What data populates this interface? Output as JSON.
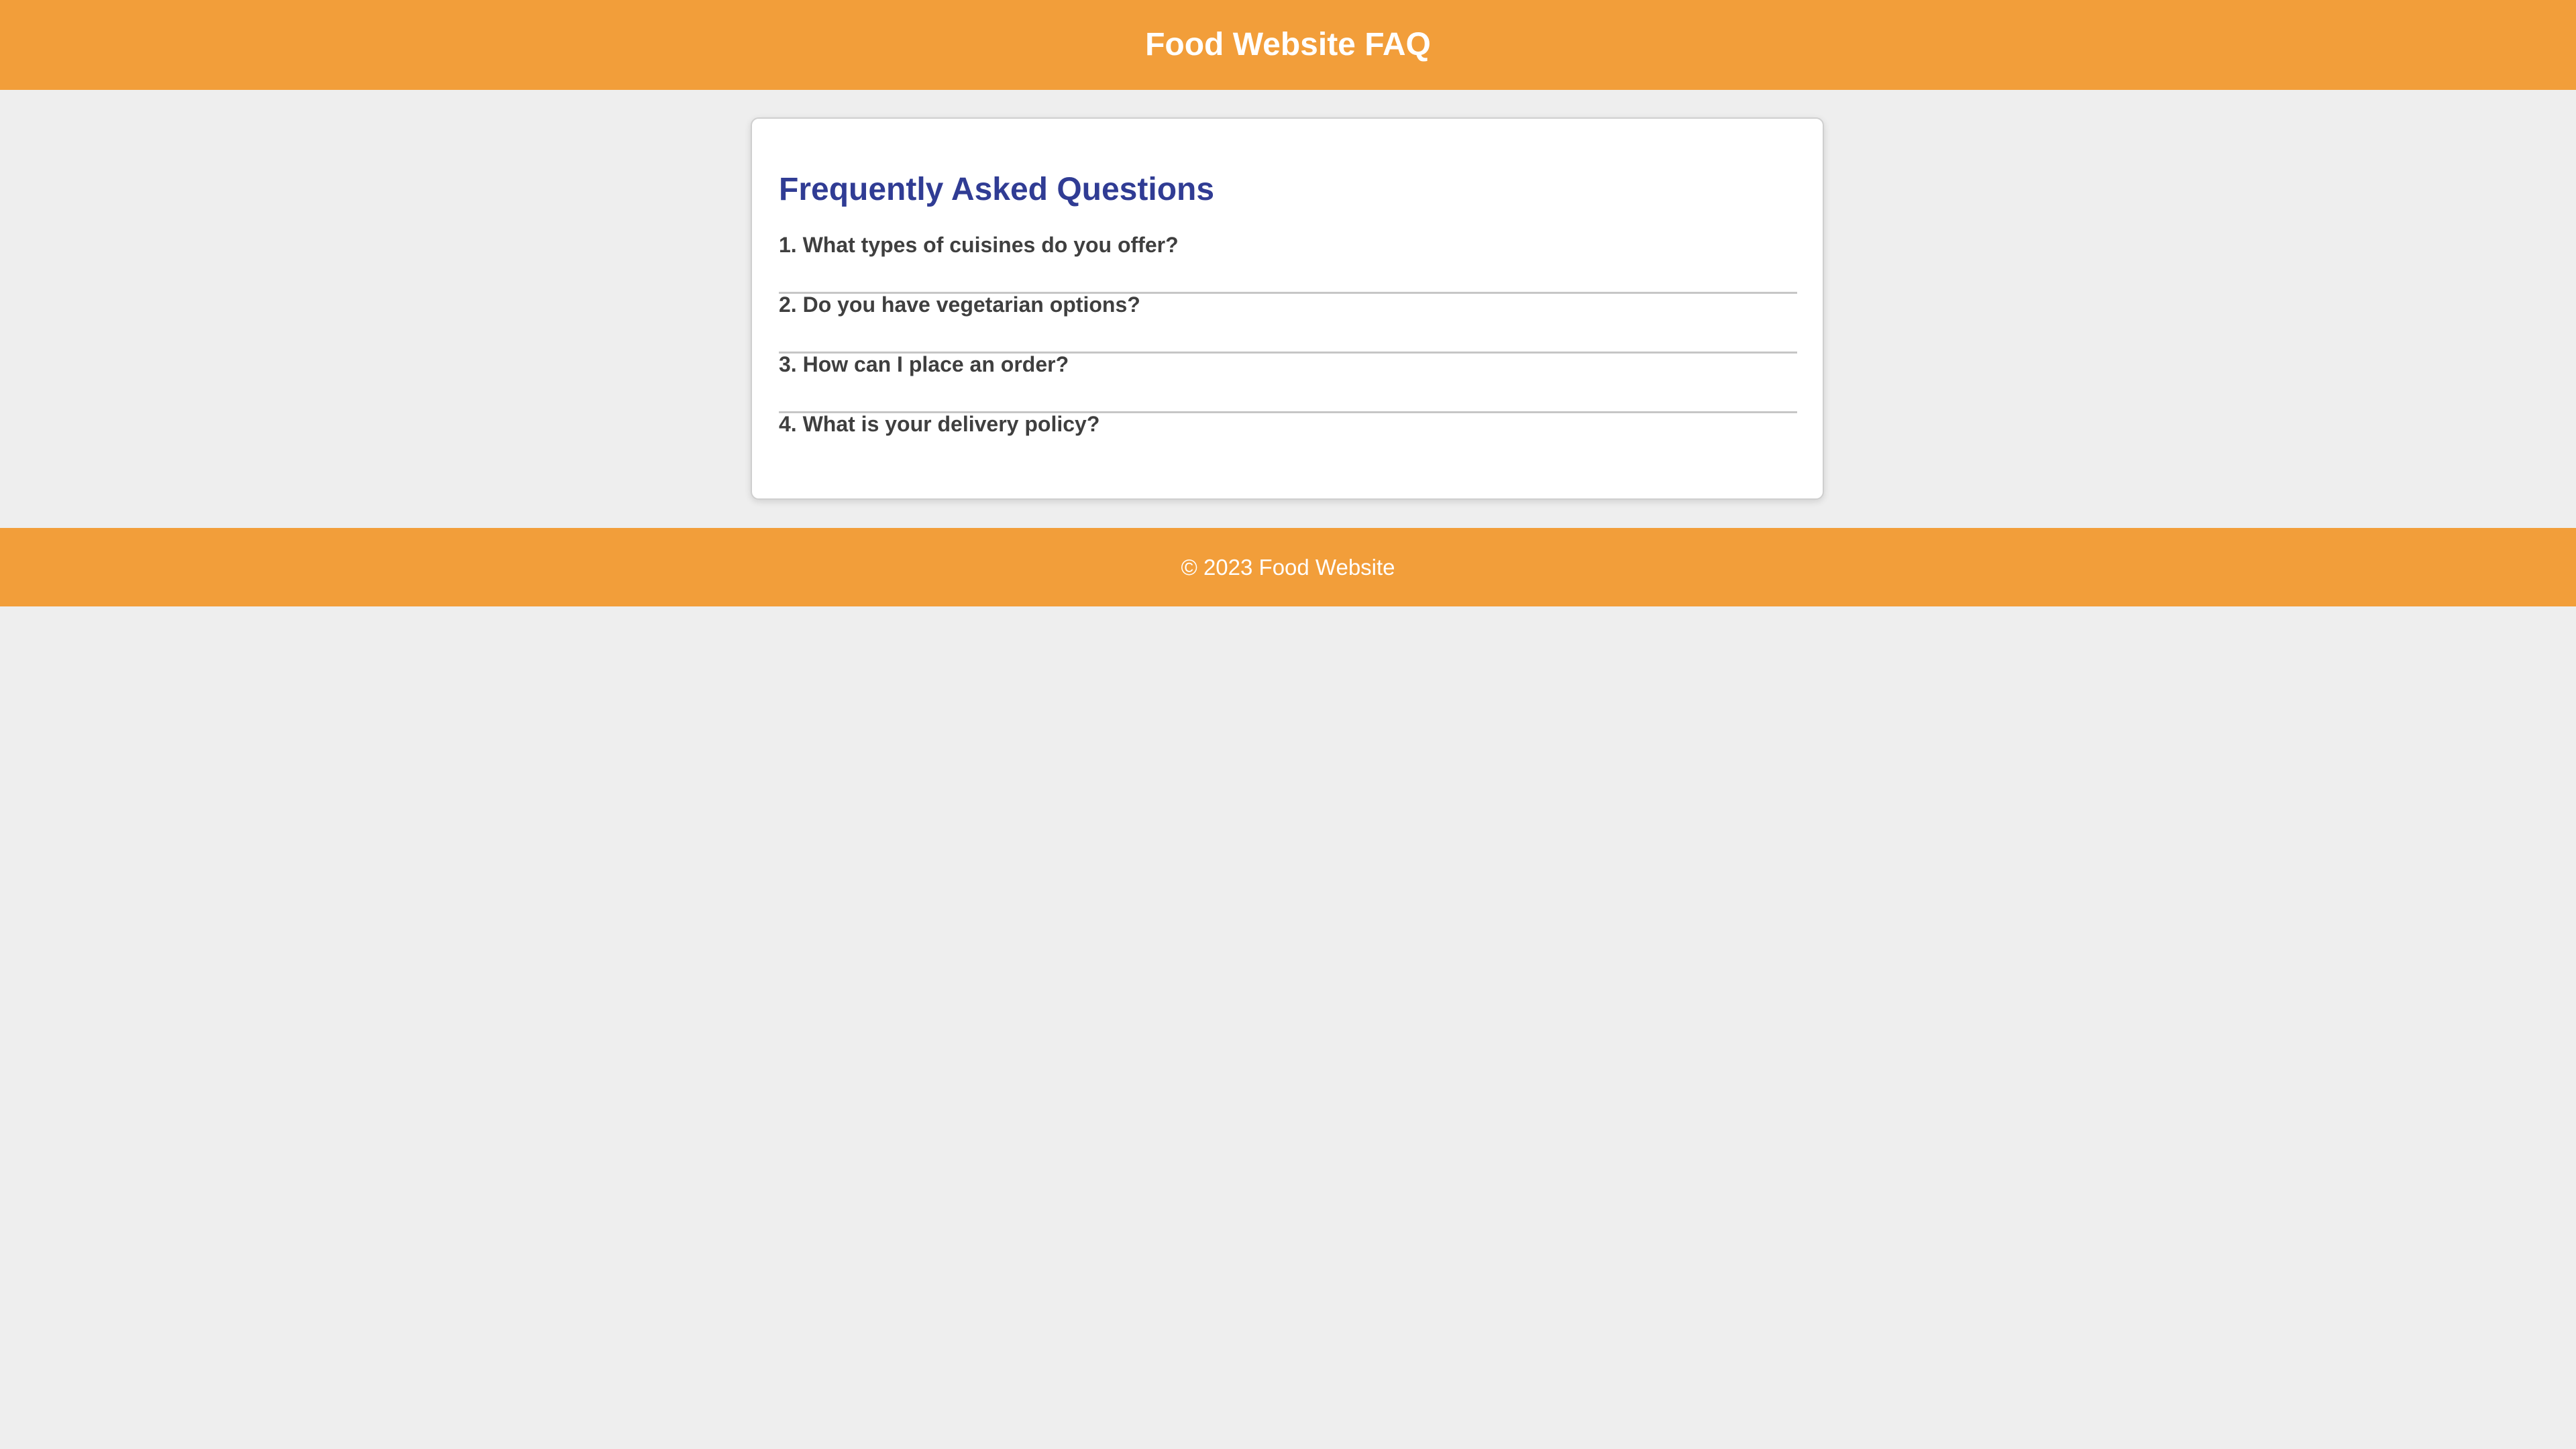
{
  "header": {
    "title": "Food Website FAQ"
  },
  "faq": {
    "heading": "Frequently Asked Questions",
    "questions": [
      "1. What types of cuisines do you offer?",
      "2. Do you have vegetarian options?",
      "3. How can I place an order?",
      "4. What is your delivery policy?"
    ]
  },
  "footer": {
    "text": "© 2023 Food Website"
  },
  "colors": {
    "accent": "#f29e3a",
    "heading": "#303c94",
    "background": "#eeeeee",
    "question_text": "#3f3f3f"
  }
}
